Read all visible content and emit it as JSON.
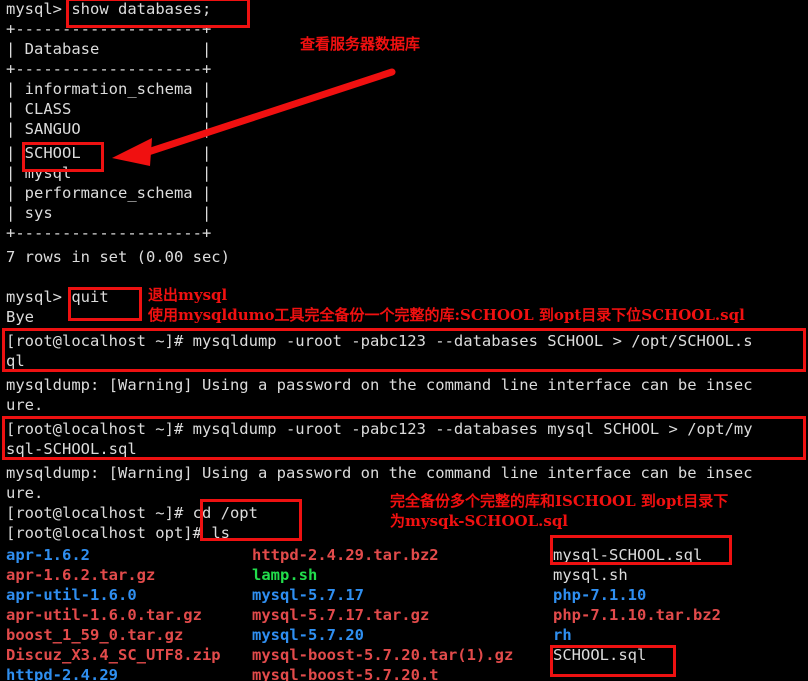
{
  "terminal": {
    "prompt_mysql": "mysql>",
    "prompt_root_home": "[root@localhost ~]#",
    "prompt_root_opt": "[root@localhost opt]#",
    "lines": {
      "l1_prompt": "mysql> ",
      "l1_cmd": "show databases;",
      "l2_border": "+--------------------+",
      "l3_row": "| Database           |",
      "l4_border": "+--------------------+",
      "l5": "| information_schema |",
      "l6": "| CLASS              |",
      "l7": "| SANGUO             |",
      "l8_pre": "| ",
      "l8_db": "SCHOOL",
      "l8_post": "             |",
      "l9": "| mysql              |",
      "l10": "| performance_schema |",
      "l11": "| sys                |",
      "l12_border": "+--------------------+",
      "l13_rows": "7 rows in set (0.00 sec)",
      "l14_prompt": "mysql> ",
      "l14_cmd": "quit",
      "l15_bye": "Bye",
      "l16_prompt": "[root@localhost ~]# ",
      "l16_cmd": "mysqldump -uroot -pabc123 --databases SCHOOL > /opt/SCHOOL.s",
      "l17_cmd_wrap": "ql",
      "l18_warn": "mysqldump: [Warning] Using a password on the command line interface can be insec",
      "l19_warn_wrap": "ure.",
      "l20_prompt": "[root@localhost ~]# ",
      "l20_cmd": "mysqldump -uroot -pabc123 --databases mysql SCHOOL > /opt/my",
      "l21_cmd_wrap": "sql-SCHOOL.sql",
      "l22_warn": "mysqldump: [Warning] Using a password on the command line interface can be insec",
      "l23_warn_wrap": "ure.",
      "l24_prompt": "[root@localhost ~]# ",
      "l24_cmd": "cd /opt",
      "l25_prompt": "[root@localhost opt]# ",
      "l25_cmd": "ls"
    }
  },
  "listing": {
    "col1": [
      {
        "name": "apr-1.6.2",
        "color": "blue"
      },
      {
        "name": "apr-1.6.2.tar.gz",
        "color": "red"
      },
      {
        "name": "apr-util-1.6.0",
        "color": "blue"
      },
      {
        "name": "apr-util-1.6.0.tar.gz",
        "color": "red"
      },
      {
        "name": "boost_1_59_0.tar.gz",
        "color": "red"
      },
      {
        "name": "Discuz_X3.4_SC_UTF8.zip",
        "color": "red"
      },
      {
        "name": "httpd-2.4.29",
        "color": "blue"
      }
    ],
    "col2": [
      {
        "name": "httpd-2.4.29.tar.bz2",
        "color": "red"
      },
      {
        "name": "lamp.sh",
        "color": "green"
      },
      {
        "name": "mysql-5.7.17",
        "color": "blue"
      },
      {
        "name": "mysql-5.7.17.tar.gz",
        "color": "red"
      },
      {
        "name": "mysql-5.7.20",
        "color": "blue"
      },
      {
        "name": "mysql-boost-5.7.20.tar(1).gz",
        "color": "red"
      },
      {
        "name": "mysql-boost-5.7.20.t",
        "color": "red"
      }
    ],
    "col3": [
      {
        "name": "mysql-SCHOOL.sql",
        "color": "white"
      },
      {
        "name": "mysql.sh",
        "color": "white"
      },
      {
        "name": "php-7.1.10",
        "color": "blue"
      },
      {
        "name": "php-7.1.10.tar.bz2",
        "color": "red"
      },
      {
        "name": "rh",
        "color": "blue"
      },
      {
        "name": "SCHOOL.sql",
        "color": "white"
      }
    ]
  },
  "annotations": {
    "view_databases": "查看服务器数据库",
    "quit_mysql": "退出mysql",
    "mysqldump_single": "使用mysqldumo工具完全备份一个完整的库:SCHOOL 到opt目录下位SCHOOL.sql",
    "backup_multi_line1": "完全备份多个完整的库和ISCHOOL 到opt目录下",
    "backup_multi_line2": "为mysqk-SCHOOL.sql"
  },
  "colors": {
    "annotation_red": "#f01010",
    "box_red": "#ee1111",
    "terminal_bg": "#000000",
    "terminal_fg": "#dcdcdc",
    "dir_blue": "#2f8ff0",
    "archive_red": "#e24b4b",
    "exec_green": "#22dd4c"
  }
}
